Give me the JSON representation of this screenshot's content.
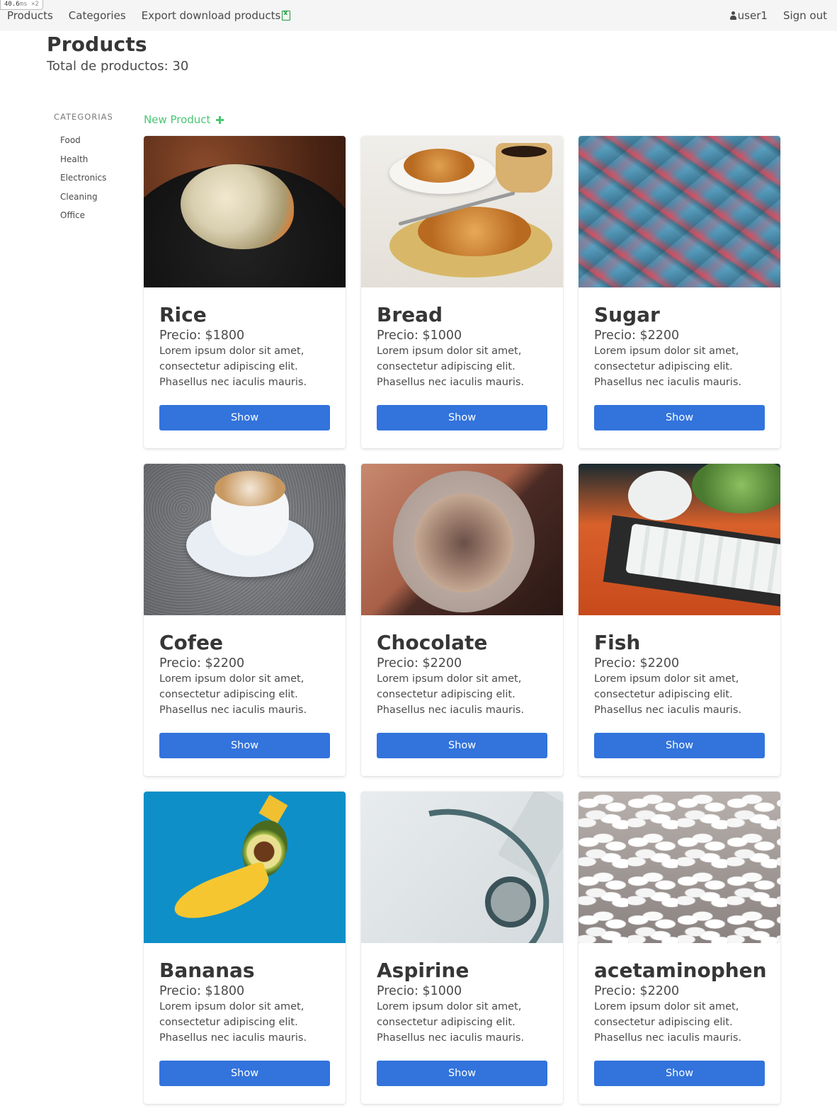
{
  "perf": {
    "time": "40.6",
    "unit": "ms",
    "mult": "×2"
  },
  "navbar": {
    "products": "Products",
    "categories": "Categories",
    "export": "Export download products",
    "user": "user1",
    "signout": "Sign out"
  },
  "header": {
    "title": "Products",
    "total": "Total de productos: 30"
  },
  "sidebar": {
    "label": "CATEGORIAS",
    "items": [
      {
        "label": "Food"
      },
      {
        "label": "Health"
      },
      {
        "label": "Electronics"
      },
      {
        "label": "Cleaning"
      },
      {
        "label": "Office"
      }
    ]
  },
  "new_product_label": "New Product",
  "products": [
    {
      "name": "Rice",
      "price": "Precio: $1800",
      "description": "Lorem ipsum dolor sit amet, consectetur adipiscing elit. Phasellus nec iaculis mauris.",
      "button": "Show"
    },
    {
      "name": "Bread",
      "price": "Precio: $1000",
      "description": "Lorem ipsum dolor sit amet, consectetur adipiscing elit. Phasellus nec iaculis mauris.",
      "button": "Show"
    },
    {
      "name": "Sugar",
      "price": "Precio: $2200",
      "description": "Lorem ipsum dolor sit amet, consectetur adipiscing elit. Phasellus nec iaculis mauris.",
      "button": "Show"
    },
    {
      "name": "Cofee",
      "price": "Precio: $2200",
      "description": "Lorem ipsum dolor sit amet, consectetur adipiscing elit. Phasellus nec iaculis mauris.",
      "button": "Show"
    },
    {
      "name": "Chocolate",
      "price": "Precio: $2200",
      "description": "Lorem ipsum dolor sit amet, consectetur adipiscing elit. Phasellus nec iaculis mauris.",
      "button": "Show"
    },
    {
      "name": "Fish",
      "price": "Precio: $2200",
      "description": "Lorem ipsum dolor sit amet, consectetur adipiscing elit. Phasellus nec iaculis mauris.",
      "button": "Show"
    },
    {
      "name": "Bananas",
      "price": "Precio: $1800",
      "description": "Lorem ipsum dolor sit amet, consectetur adipiscing elit. Phasellus nec iaculis mauris.",
      "button": "Show"
    },
    {
      "name": "Aspirine",
      "price": "Precio: $1000",
      "description": "Lorem ipsum dolor sit amet, consectetur adipiscing elit. Phasellus nec iaculis mauris.",
      "button": "Show"
    },
    {
      "name": "acetaminophen",
      "price": "Precio: $2200",
      "description": "Lorem ipsum dolor sit amet, consectetur adipiscing elit. Phasellus nec iaculis mauris.",
      "button": "Show"
    }
  ],
  "colors": {
    "accent": "#3273dc",
    "success": "#48c774",
    "navbar_bg": "#f5f5f5",
    "text": "#363636"
  },
  "icons": {
    "user": "user-icon",
    "export": "excel-file-icon",
    "new_product": "plus-icon"
  }
}
